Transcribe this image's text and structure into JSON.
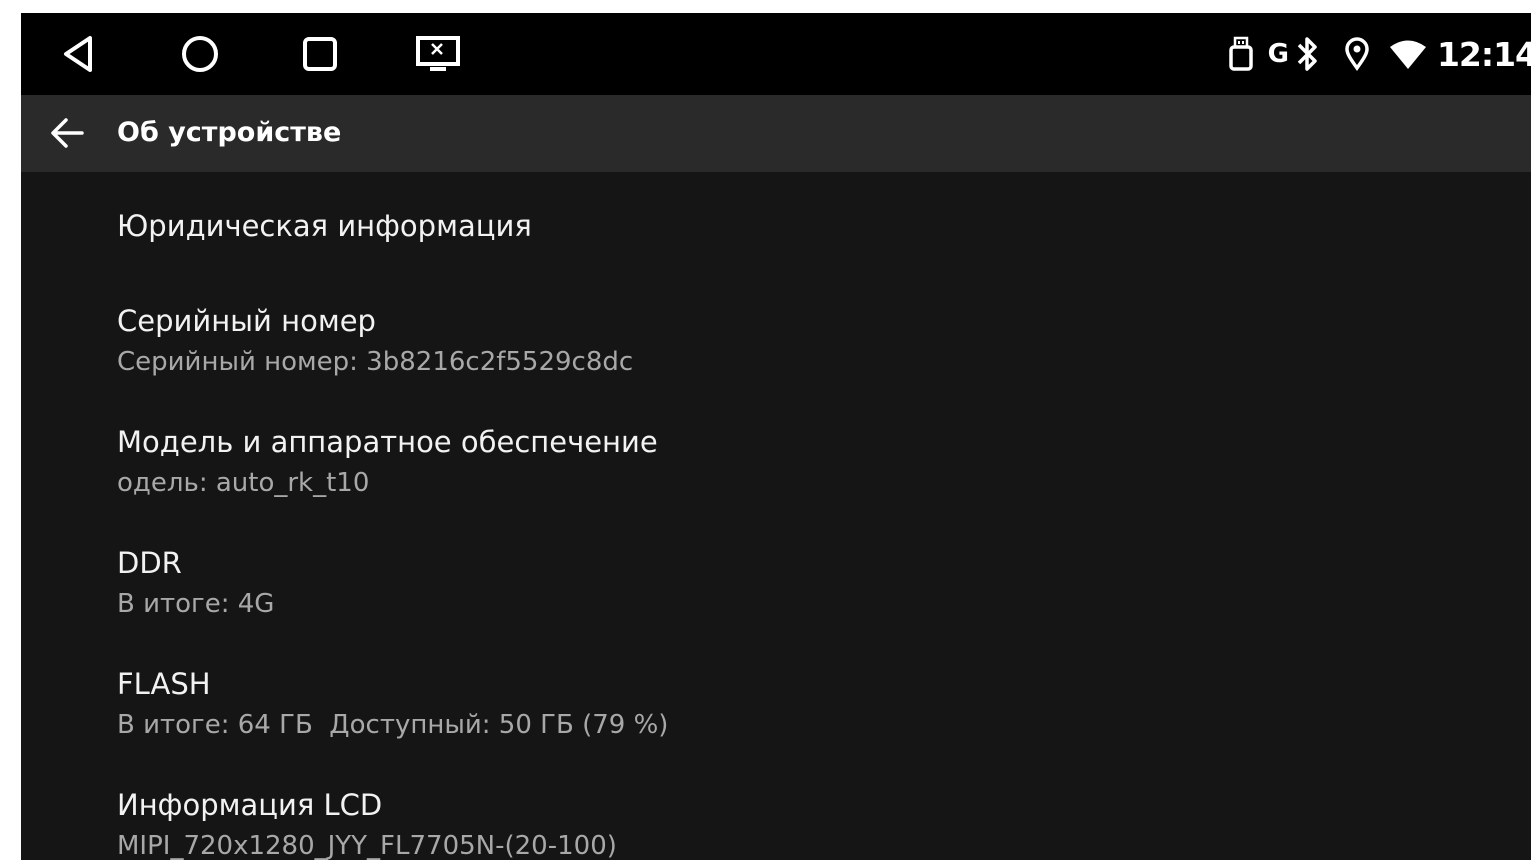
{
  "status_bar": {
    "time": "12:14",
    "nav": {
      "back": "back-triangle-icon",
      "home": "home-circle-icon",
      "recents": "recents-square-icon",
      "screen": "screen-cast-icon"
    },
    "g_indicator": "G"
  },
  "action_bar": {
    "title": "Об устройстве"
  },
  "items": [
    {
      "title": "Юридическая информация",
      "summary": ""
    },
    {
      "title": "Серийный номер",
      "summary": "Серийный номер: 3b8216c2f5529c8dc"
    },
    {
      "title": "Модель и аппаратное обеспечение",
      "summary": "одель: auto_rk_t10"
    },
    {
      "title": "DDR",
      "summary": "В итоге: 4G"
    },
    {
      "title": "FLASH",
      "summary": "В итоге: 64 ГБ  Доступный: 50 ГБ (79 %)"
    },
    {
      "title": "Информация LCD",
      "summary": "MIPI_720x1280_JYY_FL7705N-(20-100)"
    }
  ],
  "colors": {
    "background": "#151515",
    "status_bar": "#000000",
    "action_bar": "#2a2a2a",
    "title_text": "#f2f2f2",
    "summary_text": "#a8a8a8"
  }
}
